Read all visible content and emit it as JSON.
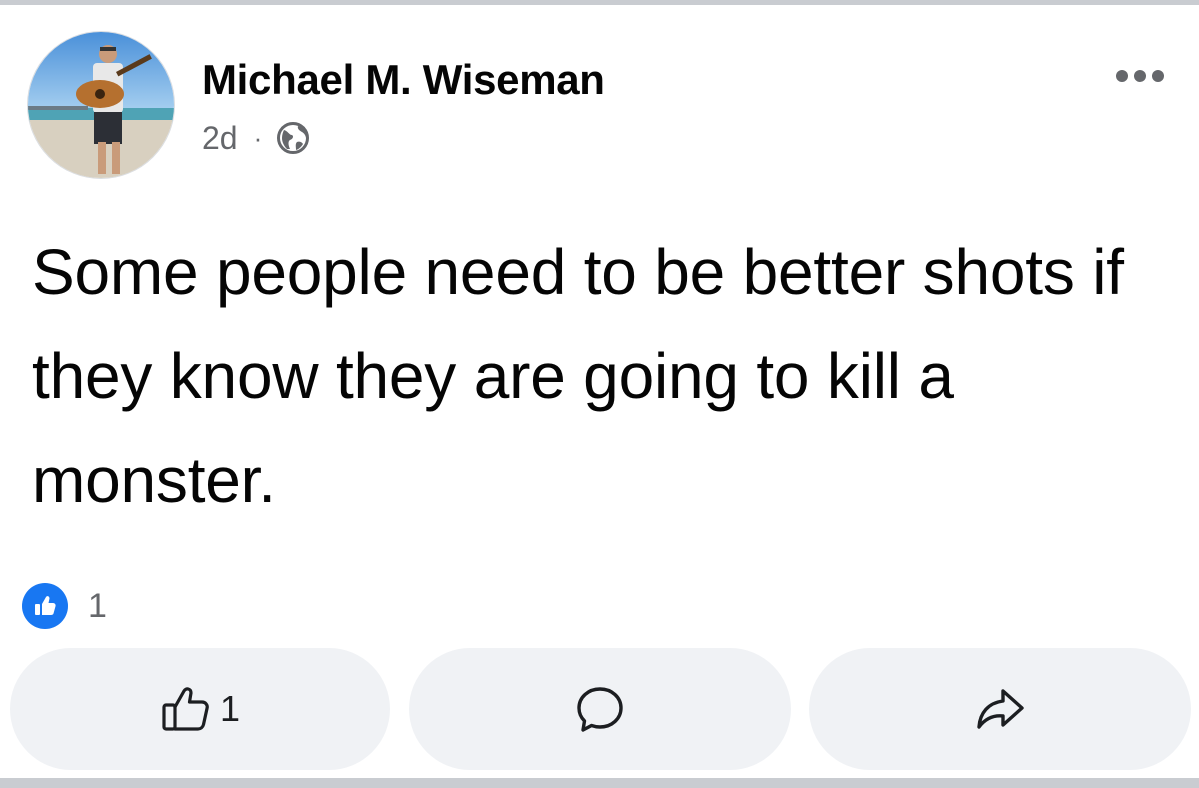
{
  "post": {
    "author": "Michael M. Wiseman",
    "time": "2d",
    "separator": "·",
    "privacy_icon": "globe-icon",
    "text": "Some people need to be better shots if they know they are going to kill a monster."
  },
  "reactions": {
    "icon": "like-reaction-icon",
    "count": "1"
  },
  "actions": {
    "like_count": "1",
    "like_icon": "thumbs-up-icon",
    "comment_icon": "comment-icon",
    "share_icon": "share-icon"
  },
  "colors": {
    "accent": "#1877f2",
    "muted_text": "#65676b",
    "button_bg": "#f0f2f5",
    "text": "#050505"
  }
}
